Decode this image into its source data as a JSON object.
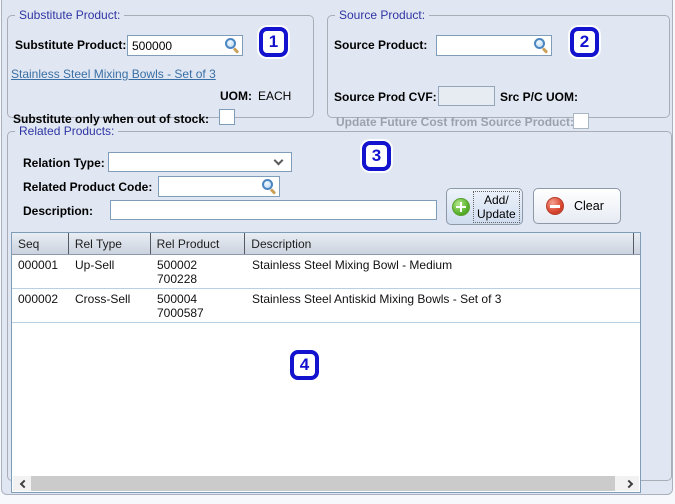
{
  "colors": {
    "annotation_blue": "#1212cf",
    "link_blue": "#3a6fa5",
    "group_title_blue": "#2e35a3",
    "add_green": "#58b22e",
    "clear_red": "#d6402c",
    "panel_bg": "#e1e7f2"
  },
  "annotations": {
    "badge1": "1",
    "badge2": "2",
    "badge3": "3",
    "badge4": "4"
  },
  "substitute_group": {
    "title": "Substitute Product:",
    "product_label": "Substitute Product:",
    "product_value": "500000",
    "product_link": "Stainless Steel Mixing Bowls - Set of 3",
    "uom_label": "UOM:",
    "uom_value": "EACH",
    "out_of_stock_label": "Substitute only when out of stock:"
  },
  "source_group": {
    "title": "Source Product:",
    "product_label": "Source Product:",
    "product_value": "",
    "cvf_label": "Source Prod CVF:",
    "cvf_value": "",
    "src_uom_label": "Src P/C UOM:",
    "update_future_label": "Update Future Cost from Source Product:"
  },
  "related_group": {
    "title": "Related Products:",
    "relation_type_label": "Relation Type:",
    "relation_type_value": "",
    "related_code_label": "Related Product Code:",
    "related_code_value": "",
    "description_label": "Description:",
    "description_value": "",
    "add_update_button": {
      "line1": "Add/",
      "line2": "Update"
    },
    "clear_button": "Clear"
  },
  "table": {
    "columns": [
      "Seq",
      "Rel Type",
      "Rel Product",
      "Description"
    ],
    "rows": [
      {
        "seq": "000001",
        "rel_type": "Up-Sell",
        "rel_product_line1": "500002",
        "rel_product_line2": "700228",
        "description": "Stainless Steel Mixing Bowl - Medium"
      },
      {
        "seq": "000002",
        "rel_type": "Cross-Sell",
        "rel_product_line1": "500004",
        "rel_product_line2": "7000587",
        "description": "Stainless Steel Antiskid Mixing Bowls - Set of 3"
      }
    ]
  },
  "icons": {
    "search": "magnifier",
    "add": "plus-circle",
    "clear": "minus-circle",
    "relation_dropdown": "chevron-down",
    "scrollbar_left": "chevron-left",
    "scrollbar_right": "chevron-right"
  }
}
